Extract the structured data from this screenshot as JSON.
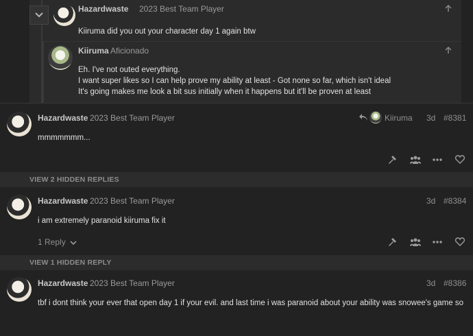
{
  "embedded_reply": {
    "username": "Hazardwaste",
    "title": "2023 Best Team Player",
    "text": "Kiiruma did you out your character day 1 again btw"
  },
  "nested_reply": {
    "username": "Kiiruma",
    "title": "Aficionado",
    "lines": [
      "Eh. I've not outed everything.",
      "I want super likes so I can help prove my ability at least - Got none so far, which isn't ideal",
      "It's going makes me look a bit sus initially when it happens but it'll be proven at least"
    ]
  },
  "posts": [
    {
      "username": "Hazardwaste",
      "title": "2023 Best Team Player",
      "reply_to": "Kiiruma",
      "date": "3d",
      "number": "#8381",
      "text": "mmmmmmm..."
    },
    {
      "username": "Hazardwaste",
      "title": "2023 Best Team Player",
      "date": "3d",
      "number": "#8384",
      "text": "i am extremely paranoid kiiruma fix it",
      "replies_label": "1 Reply"
    },
    {
      "username": "Hazardwaste",
      "title": "2023 Best Team Player",
      "date": "3d",
      "number": "#8386",
      "text": "tbf i dont think your ever that open day 1 if your evil. and last time i was paranoid about your ability was snowee's game so"
    }
  ],
  "hidden_replies": [
    "VIEW 2 HIDDEN REPLIES",
    "VIEW 1 HIDDEN REPLY"
  ],
  "icons": [
    "collapse-chevron-icon",
    "arrow-up-icon",
    "reply-arrow-icon",
    "hammer-icon",
    "users-icon",
    "more-icon",
    "heart-icon",
    "chevron-down-icon"
  ],
  "colors": {
    "background": "#222222",
    "embedded_bg": "#2b2b2b",
    "hidden_bar_bg": "#2c2c2c",
    "muted": "#9a9a9a"
  }
}
